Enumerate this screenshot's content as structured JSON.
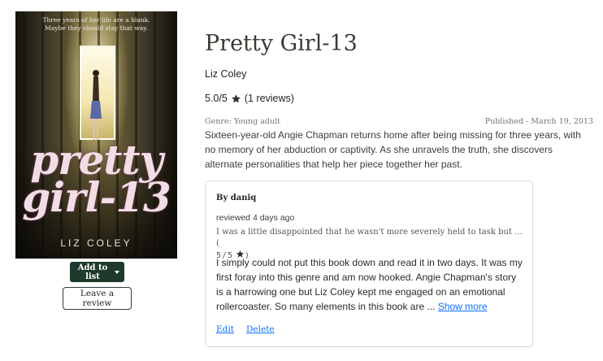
{
  "book": {
    "title": "Pretty Girl-13",
    "author": "Liz Coley",
    "rating_text": "5.0/5",
    "review_count": "(1 reviews)",
    "genre": "Genre: Young adult",
    "published": "Published - March 19, 2013",
    "description": "Sixteen-year-old Angie Chapman returns home after being missing for three years, with no memory of her abduction or captivity. As she unravels the truth, she discovers alternate personalities that help her piece together her past.",
    "cover": {
      "tagline_line1": "Three years of her life are a blank.",
      "tagline_line2": "Maybe they should stay that way.",
      "title_line1": "pretty",
      "title_line2": "girl-13",
      "author": "LIZ COLEY"
    }
  },
  "actions": {
    "add_to_list": "Add to list",
    "leave_review": "Leave a review"
  },
  "review": {
    "by": "By daniq",
    "reviewed": "reviewed 4 days ago",
    "headline": "I was a little disappointed that he wasn't more severely held to task but ... (",
    "headline_rating": "5/5",
    "headline_close": ")",
    "text": "I simply could not put this book down and read it in two days. It was my first foray into this genre and am now hooked. Angie Chapman's story is a harrowing one but Liz Coley kept me engaged on an emotional rollercoaster. So many elements in this book are ...",
    "show_more": "Show more",
    "edit": "Edit",
    "delete": "Delete"
  },
  "colors": {
    "primary_button": "#1e3a2c",
    "link": "#0d6efd"
  },
  "icons": {
    "rating_star": "star-icon",
    "dropdown": "caret-down-icon"
  }
}
